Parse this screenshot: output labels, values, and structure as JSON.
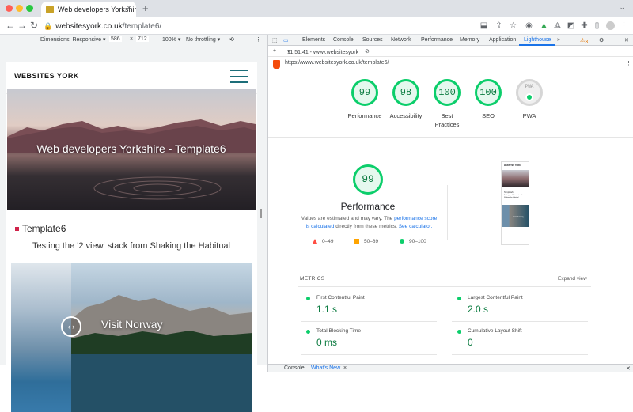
{
  "browser": {
    "tab_title": "Web developers Yorkshire - T",
    "tab_close": "×",
    "new_tab": "+",
    "url_host": "websitesyork.co.uk",
    "url_path": "/template6/",
    "tabs_dropdown": "⌄"
  },
  "device_toolbar": {
    "dimensions": "Dimensions: Responsive ▾",
    "width": "586",
    "times": "×",
    "height": "712",
    "zoom": "100% ▾",
    "throttling": "No throttling ▾"
  },
  "website": {
    "logo": "WEBSITES YORK",
    "hero_title": "Web developers Yorkshire - Template6",
    "section_title": "Template6",
    "section_subtitle": "Testing the '2 view' stack from Shaking the Habitual",
    "slider_title": "Visit Norway",
    "slider_handle": "‹ ›"
  },
  "devtools": {
    "tabs": [
      "Elements",
      "Console",
      "Sources",
      "Network",
      "Performance",
      "Memory",
      "Application",
      "Lighthouse",
      "»"
    ],
    "active_tab": "Lighthouse",
    "warning_count": "3",
    "report_time": "11:51:41 - www.websitesyork",
    "report_url": "https://www.websitesyork.co.uk/template6/",
    "drawer_tabs": [
      "Console",
      "What's New",
      "×"
    ]
  },
  "lighthouse": {
    "scores": [
      {
        "value": "99",
        "label": "Performance"
      },
      {
        "value": "98",
        "label": "Accessibility"
      },
      {
        "value": "100",
        "label": "Best Practices"
      },
      {
        "value": "100",
        "label": "SEO"
      },
      {
        "value": "PWA",
        "label": "PWA"
      }
    ],
    "performance": {
      "score": "99",
      "title": "Performance",
      "desc_1": "Values are estimated and may vary. The ",
      "desc_link1": "performance score is calculated",
      "desc_2": " directly from these metrics. ",
      "desc_link2": "See calculator.",
      "legend": [
        {
          "range": "0–49",
          "color": "#ff4e42"
        },
        {
          "range": "50–89",
          "color": "#ffa400"
        },
        {
          "range": "90–100",
          "color": "#0cce6b"
        }
      ]
    },
    "metrics_header": "METRICS",
    "expand_label": "Expand view",
    "metrics": [
      {
        "name": "First Contentful Paint",
        "value": "1.1 s"
      },
      {
        "name": "Largest Contentful Paint",
        "value": "2.0 s"
      },
      {
        "name": "Total Blocking Time",
        "value": "0 ms"
      },
      {
        "name": "Cumulative Layout Shift",
        "value": "0"
      }
    ],
    "thumb": {
      "logo": "WEBSITES YORK",
      "section": "Template6",
      "sub": "Testing the '2 view' stack from Shaking the Habitual",
      "slide": "Visit Norway"
    }
  },
  "colors": {
    "good": "#0cce6b",
    "accent": "#1a73e8",
    "brand_red": "#d0234a",
    "teal": "#1c6e79"
  }
}
